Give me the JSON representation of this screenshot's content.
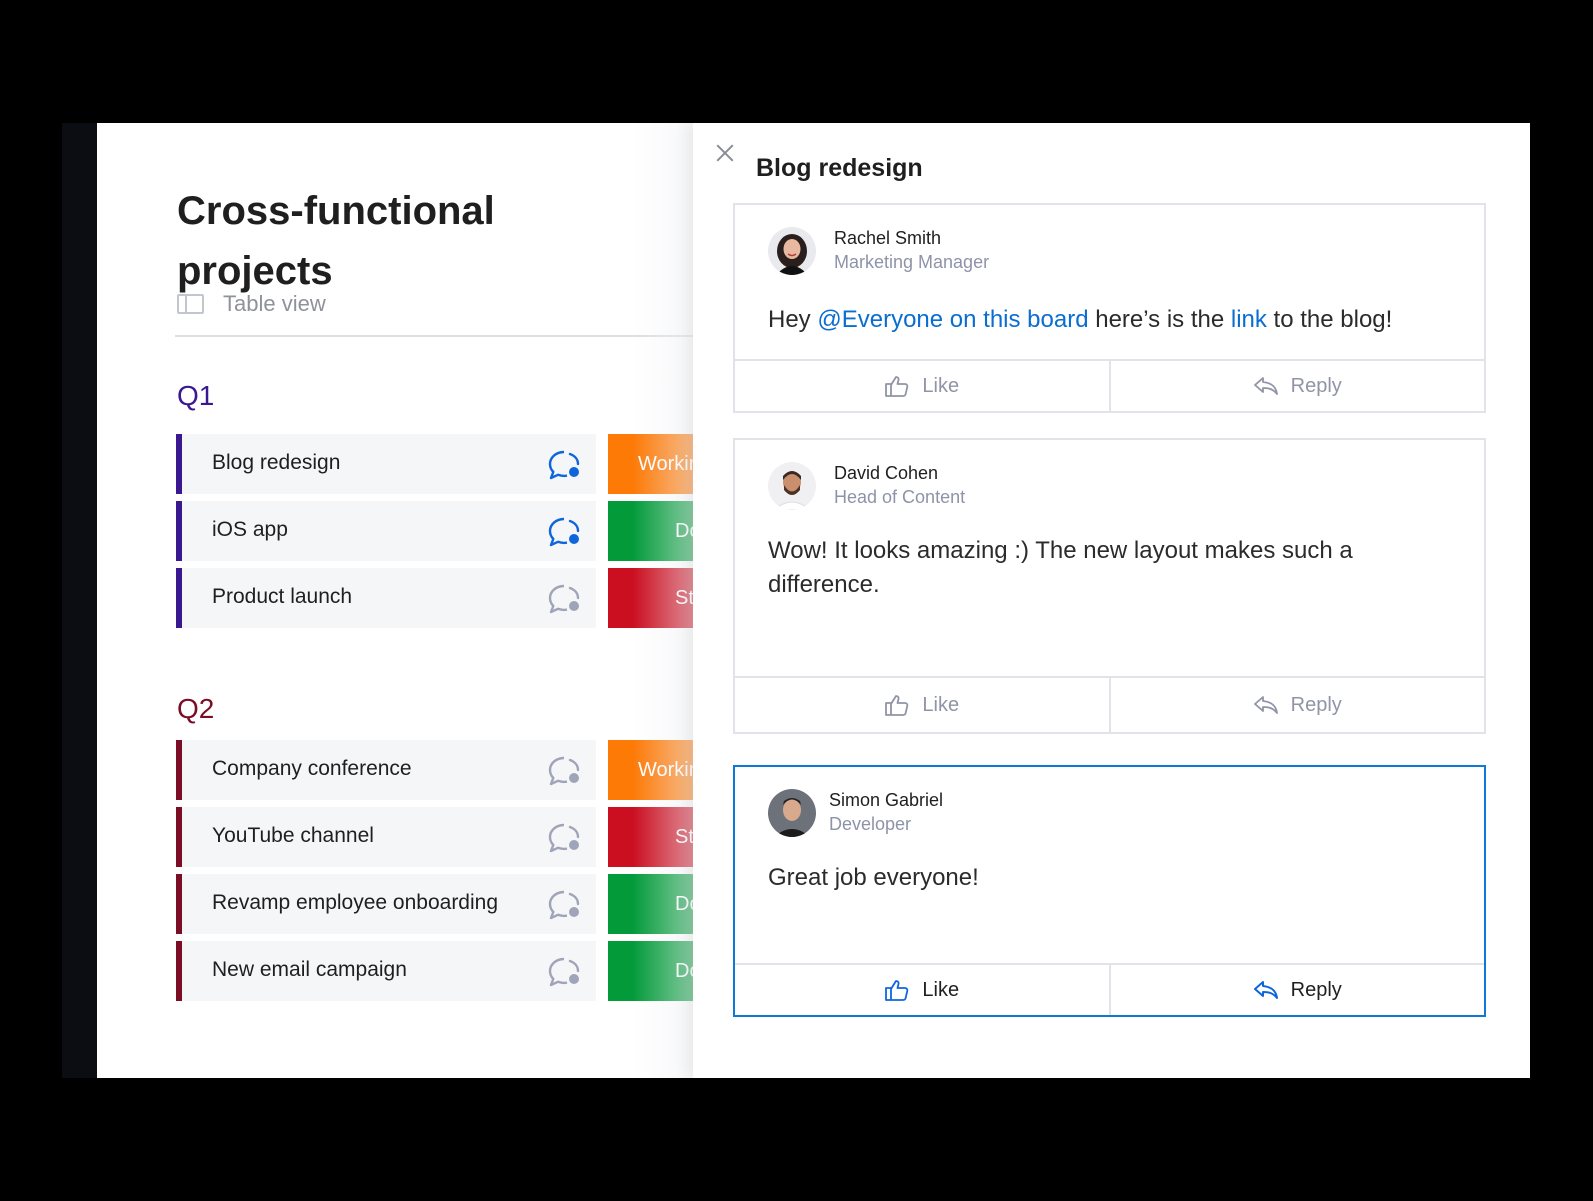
{
  "board": {
    "title": "Cross-functional projects",
    "view_label": "Table view",
    "groups": [
      {
        "name": "Q1",
        "color": "#3a1890",
        "tasks": [
          {
            "name": "Blog redesign",
            "status": "Working on it",
            "status_color": "#fd7a07",
            "has_updates": true
          },
          {
            "name": "iOS app",
            "status": "Done",
            "status_color": "#039b3a",
            "has_updates": true
          },
          {
            "name": "Product launch",
            "status": "Stuck",
            "status_color": "#cb0f21",
            "has_updates": false
          }
        ]
      },
      {
        "name": "Q2",
        "color": "#7b0e24",
        "tasks": [
          {
            "name": "Company conference",
            "status": "Working on it",
            "status_color": "#fd7a07",
            "has_updates": false
          },
          {
            "name": "YouTube channel",
            "status": "Stuck",
            "status_color": "#cb0f21",
            "has_updates": false
          },
          {
            "name": "Revamp employee onboarding",
            "status": "Done",
            "status_color": "#039b3a",
            "has_updates": false
          },
          {
            "name": "New email campaign",
            "status": "Done",
            "status_color": "#039b3a",
            "has_updates": false
          }
        ]
      }
    ]
  },
  "panel": {
    "title": "Blog redesign",
    "updates": [
      {
        "author": "Rachel Smith",
        "role": "Marketing Manager",
        "message_parts": [
          {
            "text": "Hey ",
            "mention": false
          },
          {
            "text": "@Everyone on this board",
            "mention": true
          },
          {
            "text": " here’s is the ",
            "mention": false
          },
          {
            "text": "link",
            "mention": true
          },
          {
            "text": " to the blog!",
            "mention": false
          }
        ],
        "like_label": "Like",
        "reply_label": "Reply",
        "active": false
      },
      {
        "author": "David Cohen",
        "role": "Head of Content",
        "message_parts": [
          {
            "text": "Wow! It looks amazing :) The new layout makes such a difference.",
            "mention": false
          }
        ],
        "like_label": "Like",
        "reply_label": "Reply",
        "active": false
      },
      {
        "author": "Simon Gabriel",
        "role": "Developer",
        "message_parts": [
          {
            "text": "Great job everyone!",
            "mention": false
          }
        ],
        "like_label": "Like",
        "reply_label": "Reply",
        "active": true
      }
    ]
  },
  "icons": {
    "close": "close-icon",
    "table_view": "table-view-icon",
    "updates": "chat-bubble-icon",
    "like": "thumbs-up-icon",
    "reply": "reply-arrow-icon"
  },
  "colors": {
    "accent": "#0a6ed1",
    "updates_active": "#0f66dc",
    "updates_inactive": "#a0a4b8"
  }
}
